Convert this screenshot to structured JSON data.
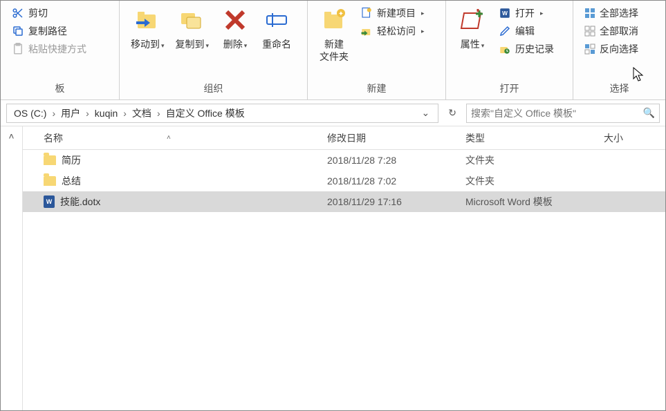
{
  "ribbon": {
    "clipboard": {
      "cut": "剪切",
      "copy_path": "复制路径",
      "paste_shortcut": "粘贴快捷方式",
      "label": "板"
    },
    "organize": {
      "move_to": "移动到",
      "copy_to": "复制到",
      "delete": "删除",
      "rename": "重命名",
      "label": "组织"
    },
    "new": {
      "new_folder": "新建\n文件夹",
      "new_item": "新建项目",
      "easy_access": "轻松访问",
      "label": "新建"
    },
    "open": {
      "properties": "属性",
      "open": "打开",
      "edit": "编辑",
      "history": "历史记录",
      "label": "打开"
    },
    "select": {
      "select_all": "全部选择",
      "select_none": "全部取消",
      "invert": "反向选择",
      "label": "选择"
    }
  },
  "breadcrumb": {
    "items": [
      "OS (C:)",
      "用户",
      "kuqin",
      "文档",
      "自定义 Office 模板"
    ]
  },
  "search": {
    "placeholder": "搜索\"自定义 Office 模板\""
  },
  "columns": {
    "name": "名称",
    "date": "修改日期",
    "type": "类型",
    "size": "大小"
  },
  "rows": [
    {
      "name": "简历",
      "date": "2018/11/28 7:28",
      "type": "文件夹",
      "icon": "folder",
      "selected": false
    },
    {
      "name": "总结",
      "date": "2018/11/28 7:02",
      "type": "文件夹",
      "icon": "folder",
      "selected": false
    },
    {
      "name": "技能.dotx",
      "date": "2018/11/29 17:16",
      "type": "Microsoft Word 模板",
      "icon": "word",
      "selected": true
    }
  ]
}
